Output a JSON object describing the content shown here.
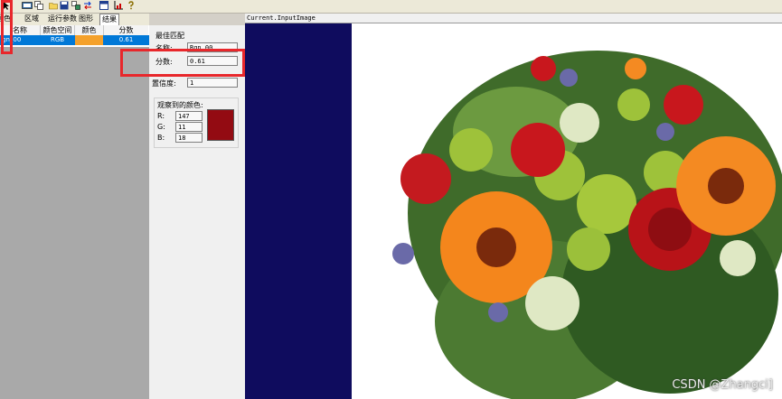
{
  "tabs": [
    {
      "label": "颜色"
    },
    {
      "label": "区域"
    },
    {
      "label": "运行参数"
    },
    {
      "label": "图形"
    },
    {
      "label": "结果"
    }
  ],
  "table": {
    "headers": [
      "名称",
      "颜色空间",
      "颜色",
      "分数"
    ],
    "rows": [
      {
        "name": "gn_00",
        "space": "RGB",
        "color": "#f4a12c",
        "score": "0.61"
      }
    ]
  },
  "best_match": {
    "title": "最佳匹配",
    "name_label": "名称:",
    "name_value": "Rgn_00",
    "score_label": "分数:",
    "score_value": "0.61",
    "confidence_label": "置信度:",
    "confidence_value": "1"
  },
  "observed_color": {
    "title": "观察到的颜色:",
    "r_label": "R:",
    "r_value": "147",
    "g_label": "G:",
    "g_value": "11",
    "b_label": "B:",
    "b_value": "18",
    "swatch": "#930b12"
  },
  "image_panel": {
    "title": "Current.InputImage"
  },
  "watermark": "CSDN @Zhangci]",
  "colors": {
    "accent": "#0078d7",
    "highlight": "#e8272b",
    "navy": "#0f0c5e"
  }
}
